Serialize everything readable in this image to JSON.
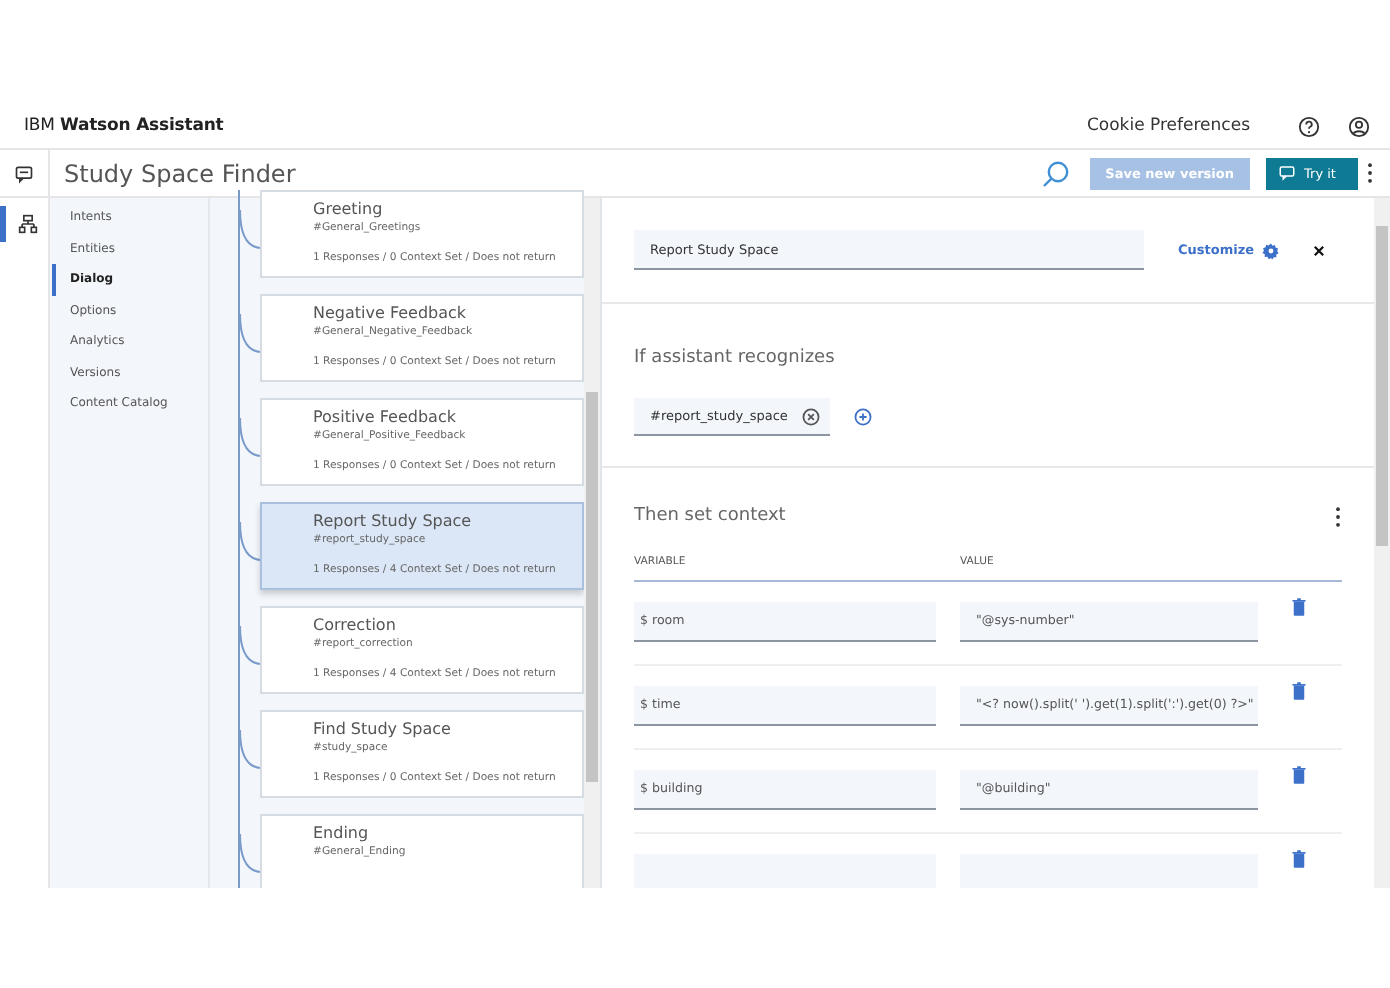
{
  "header": {
    "brand_prefix": "IBM",
    "brand_name": "Watson Assistant",
    "cookie_link": "Cookie Preferences"
  },
  "toolbar": {
    "title": "Study Space Finder",
    "save_button": "Save new version",
    "try_button": "Try it"
  },
  "nav": [
    {
      "label": "Intents",
      "selected": false
    },
    {
      "label": "Entities",
      "selected": false
    },
    {
      "label": "Dialog",
      "selected": true
    },
    {
      "label": "Options",
      "selected": false
    },
    {
      "label": "Analytics",
      "selected": false
    },
    {
      "label": "Versions",
      "selected": false
    },
    {
      "label": "Content Catalog",
      "selected": false
    }
  ],
  "nodes": [
    {
      "title": "Greeting",
      "condition": "#General_Greetings",
      "summary": "1 Responses / 0 Context Set / Does not return",
      "selected": false
    },
    {
      "title": "Negative Feedback",
      "condition": "#General_Negative_Feedback",
      "summary": "1 Responses / 0 Context Set / Does not return",
      "selected": false
    },
    {
      "title": "Positive Feedback",
      "condition": "#General_Positive_Feedback",
      "summary": "1 Responses / 0 Context Set / Does not return",
      "selected": false
    },
    {
      "title": "Report Study Space",
      "condition": "#report_study_space",
      "summary": "1 Responses / 4 Context Set / Does not return",
      "selected": true
    },
    {
      "title": "Correction",
      "condition": "#report_correction",
      "summary": "1 Responses / 4 Context Set / Does not return",
      "selected": false
    },
    {
      "title": "Find Study Space",
      "condition": "#study_space",
      "summary": "1 Responses / 0 Context Set / Does not return",
      "selected": false
    },
    {
      "title": "Ending",
      "condition": "#General_Ending",
      "selected": false
    }
  ],
  "editor": {
    "node_name": "Report Study Space",
    "customize": "Customize",
    "recognizes_heading": "If assistant recognizes",
    "condition_chip": "#report_study_space",
    "context_heading": "Then set context",
    "columns": [
      "VARIABLE",
      "VALUE"
    ],
    "context_rows": [
      {
        "variable": "$ room",
        "value": "\"@sys-number\""
      },
      {
        "variable": "$ time",
        "value": "\"<? now().split(' ').get(1).split(':').get(0) ?>\""
      },
      {
        "variable": "$ building",
        "value": "\"@building\""
      },
      {}
    ]
  }
}
